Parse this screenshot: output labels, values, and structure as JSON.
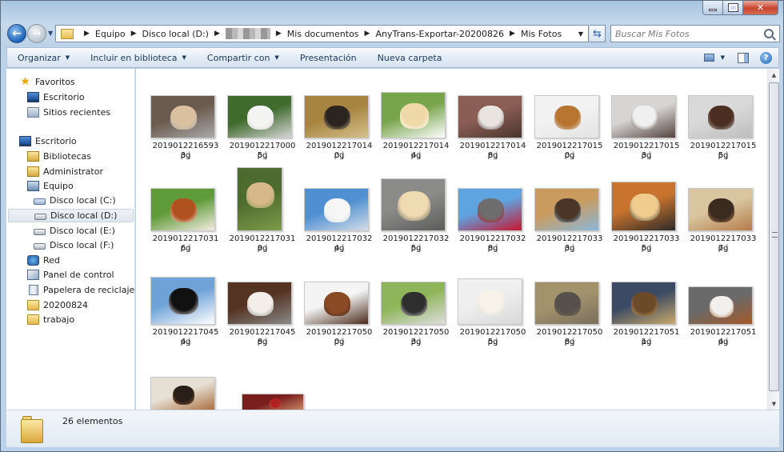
{
  "window": {
    "caption_buttons": {
      "minimize_icon": "minimize-icon",
      "maximize_icon": "maximize-icon",
      "close_icon": "close-icon"
    }
  },
  "navbar": {
    "back_icon": "back-arrow-icon",
    "forward_icon": "forward-arrow-icon",
    "breadcrumbs": [
      "Equipo",
      "Disco local (D:)",
      "",
      "Mis documentos",
      "AnyTrans-Exportar-20200826",
      "Mis Fotos"
    ],
    "search_placeholder": "Buscar Mis Fotos"
  },
  "toolbar": {
    "items": [
      {
        "label": "Organizar",
        "dropdown": true
      },
      {
        "label": "Incluir en biblioteca",
        "dropdown": true
      },
      {
        "label": "Compartir con",
        "dropdown": true
      },
      {
        "label": "Presentación",
        "dropdown": false
      },
      {
        "label": "Nueva carpeta",
        "dropdown": false
      }
    ],
    "help_label": "?"
  },
  "sidebar": {
    "items": [
      {
        "label": "Favoritos",
        "icon": "star-icon"
      },
      {
        "label": "Escritorio",
        "icon": "desktop-icon"
      },
      {
        "label": "Sitios recientes",
        "icon": "recent-places-icon"
      },
      {
        "label": "Escritorio",
        "icon": "desktop-icon"
      },
      {
        "label": "Bibliotecas",
        "icon": "libraries-icon"
      },
      {
        "label": "Administrator",
        "icon": "user-folder-icon"
      },
      {
        "label": "Equipo",
        "icon": "computer-icon"
      },
      {
        "label": "Disco local (C:)",
        "icon": "system-drive-icon"
      },
      {
        "label": "Disco local (D:)",
        "icon": "drive-icon",
        "selected": true
      },
      {
        "label": "Disco local (E:)",
        "icon": "drive-icon"
      },
      {
        "label": "Disco local (F:)",
        "icon": "drive-icon"
      },
      {
        "label": "Red",
        "icon": "network-icon"
      },
      {
        "label": "Panel de control",
        "icon": "control-panel-icon"
      },
      {
        "label": "Papelera de reciclaje",
        "icon": "recycle-bin-icon"
      },
      {
        "label": "20200824",
        "icon": "folder-icon"
      },
      {
        "label": "trabajo",
        "icon": "folder-icon"
      }
    ]
  },
  "files": [
    {
      "name_l1": "20190122165933.j",
      "name_l2": "pg",
      "colors": [
        "#6b5a4e",
        "#d9c1a0",
        "#a9a9a9"
      ]
    },
    {
      "name_l1": "20190122170005.j",
      "name_l2": "pg",
      "colors": [
        "#3f6b2c",
        "#f4f4f2",
        "#d5d5d5"
      ]
    },
    {
      "name_l1": "20190122170140.j",
      "name_l2": "pg",
      "colors": [
        "#a7843f",
        "#2c241e",
        "#d5c08c"
      ]
    },
    {
      "name_l1": "20190122170144.j",
      "name_l2": "pg",
      "colors": [
        "#78a44c",
        "#efd9a8",
        "#ffffff"
      ]
    },
    {
      "name_l1": "20190122170148.j",
      "name_l2": "pg",
      "colors": [
        "#8a5d55",
        "#e9e4e0",
        "#4a3630"
      ]
    },
    {
      "name_l1": "20190122170150.j",
      "name_l2": "pg",
      "colors": [
        "#f2f2f2",
        "#b77531",
        "#e3e3e3"
      ]
    },
    {
      "name_l1": "20190122170153.j",
      "name_l2": "pg",
      "colors": [
        "#d7d4d4",
        "#f0f0f0",
        "#54453f"
      ]
    },
    {
      "name_l1": "20190122170155.j",
      "name_l2": "pg",
      "colors": [
        "#d9d9d9",
        "#4d2e22",
        "#bdbdbd"
      ]
    },
    {
      "name_l1": "20190122170316.j",
      "name_l2": "pg",
      "colors": [
        "#5f9b38",
        "#b0521f",
        "#f4ece4"
      ]
    },
    {
      "name_l1": "20190122170319.j",
      "name_l2": "pg",
      "colors": [
        "#4d6a2f",
        "#d6b88a",
        "#7e9a4a"
      ]
    },
    {
      "name_l1": "20190122170324.j",
      "name_l2": "pg",
      "colors": [
        "#4f8fd2",
        "#f6f6f6",
        "#d4dde6"
      ]
    },
    {
      "name_l1": "20190122170325.j",
      "name_l2": "pg",
      "colors": [
        "#8b8b89",
        "#efdbb2",
        "#5c5c5a"
      ]
    },
    {
      "name_l1": "20190122170328.j",
      "name_l2": "pg",
      "colors": [
        "#5ea4e0",
        "#6d6d6d",
        "#c8152d"
      ]
    },
    {
      "name_l1": "20190122170333.j",
      "name_l2": "pg",
      "colors": [
        "#c99b5f",
        "#4a3526",
        "#8bb7da"
      ]
    },
    {
      "name_l1": "20190122170335.j",
      "name_l2": "pg",
      "colors": [
        "#c9742e",
        "#f0cc8f",
        "#2e2a28"
      ]
    },
    {
      "name_l1": "20190122170337.j",
      "name_l2": "pg",
      "colors": [
        "#d9c6a0",
        "#3a2a20",
        "#b47b4a"
      ]
    },
    {
      "name_l1": "20190122170454.j",
      "name_l2": "pg",
      "colors": [
        "#6fa3d8",
        "#111111",
        "#ffffff"
      ]
    },
    {
      "name_l1": "20190122170458.j",
      "name_l2": "pg",
      "colors": [
        "#553322",
        "#f3efe8",
        "#8a8a8a"
      ]
    },
    {
      "name_l1": "20190122170500.j",
      "name_l2": "pg",
      "colors": [
        "#f4f4f4",
        "#8a4a26",
        "#4a2a1a"
      ]
    },
    {
      "name_l1": "20190122170503.j",
      "name_l2": "pg",
      "colors": [
        "#8fb55a",
        "#2e2e2e",
        "#dedede"
      ]
    },
    {
      "name_l1": "20190122170505.j",
      "name_l2": "pg",
      "colors": [
        "#efefef",
        "#f7f3ea",
        "#d8d8d8"
      ]
    },
    {
      "name_l1": "20190122170508.j",
      "name_l2": "pg",
      "colors": [
        "#a3936d",
        "#57504a",
        "#7a6e5c"
      ]
    },
    {
      "name_l1": "20190122170511.j",
      "name_l2": "pg",
      "colors": [
        "#3c4b63",
        "#6b4a2a",
        "#c9a86c"
      ]
    },
    {
      "name_l1": "20190122170514.j",
      "name_l2": "pg",
      "colors": [
        "#6a6a6a",
        "#f2f0ec",
        "#a55a2a"
      ]
    },
    {
      "name_l1": "",
      "name_l2": "",
      "colors": [
        "#e6dfd4",
        "#2a1e18",
        "#a86a3a"
      ]
    },
    {
      "name_l1": "",
      "name_l2": "",
      "colors": [
        "#7a1e1e",
        "#b22222",
        "#cc8866"
      ]
    }
  ],
  "statusbar": {
    "count_text": "26 elementos",
    "icon": "folder-icon"
  }
}
